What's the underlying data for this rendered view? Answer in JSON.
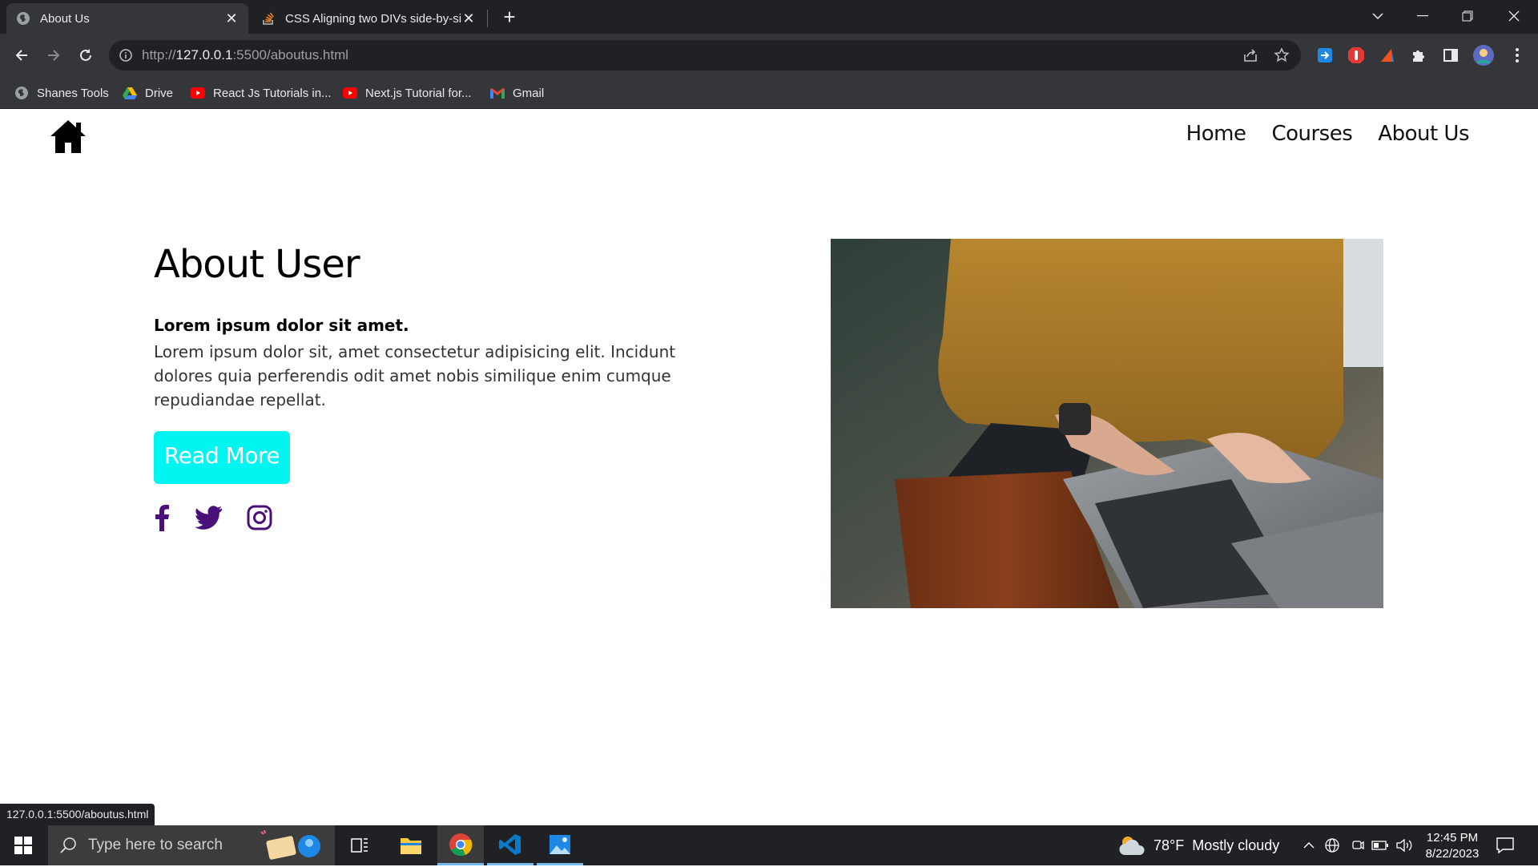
{
  "browser": {
    "tabs": [
      {
        "title": "About Us",
        "active": true,
        "icon": "globe-icon"
      },
      {
        "title": "CSS Aligning two DIVs side-by-side",
        "active": false,
        "icon": "stackoverflow-icon"
      }
    ],
    "url_prefix": "http://",
    "url_host": "127.0.0.1",
    "url_rest": ":5500/aboutus.html",
    "bookmarks": [
      {
        "label": "Shanes Tools",
        "icon": "globe-icon"
      },
      {
        "label": "Drive",
        "icon": "google-drive-icon"
      },
      {
        "label": "React Js Tutorials in...",
        "icon": "youtube-icon"
      },
      {
        "label": "Next.js Tutorial for...",
        "icon": "youtube-icon"
      },
      {
        "label": "Gmail",
        "icon": "gmail-icon"
      }
    ],
    "status_url": "127.0.0.1:5500/aboutus.html"
  },
  "site": {
    "nav": [
      {
        "label": "Home"
      },
      {
        "label": "Courses"
      },
      {
        "label": "About Us"
      }
    ],
    "about": {
      "title": "About User",
      "subtitle": "Lorem ipsum dolor sit amet.",
      "body": "Lorem ipsum dolor sit, amet consectetur adipisicing elit. Incidunt dolores quia perferendis odit amet nobis similique enim cumque repudiandae repellat.",
      "button_label": "Read More"
    },
    "social": [
      "facebook-icon",
      "twitter-icon",
      "instagram-icon"
    ],
    "colors": {
      "accent": "#00f5f0",
      "social": "#4b0f7a"
    }
  },
  "taskbar": {
    "search_placeholder": "Type here to search",
    "weather_temp": "78°F",
    "weather_desc": "Mostly cloudy",
    "time": "12:45 PM",
    "date": "8/22/2023"
  }
}
